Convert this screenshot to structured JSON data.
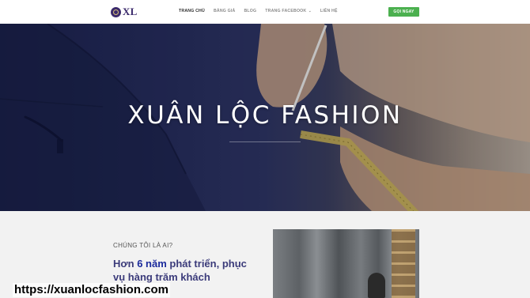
{
  "header": {
    "logo_text": "XL",
    "nav": [
      {
        "label": "TRANG CHỦ",
        "active": true
      },
      {
        "label": "BẢNG GIÁ",
        "active": false
      },
      {
        "label": "BLOG",
        "active": false
      },
      {
        "label": "TRANG FACEBOOK",
        "active": false,
        "has_dropdown": true
      },
      {
        "label": "LIÊN HỆ",
        "active": false
      }
    ],
    "cta_label": "GỌI NGAY"
  },
  "hero": {
    "title": "XUÂN LỘC FASHION"
  },
  "about": {
    "eyebrow": "CHÚNG TÔI LÀ AI?",
    "heading_pre": "Hơn ",
    "heading_highlight": "6 năm",
    "heading_post": " phát triển, phục vụ hàng trăm khách"
  },
  "overlay": {
    "url": "https://xuanlocfashion.com"
  },
  "colors": {
    "brand": "#3b2a6b",
    "cta": "#4bb04f",
    "heading": "#3b3b7a",
    "highlight": "#1c2b9c"
  }
}
